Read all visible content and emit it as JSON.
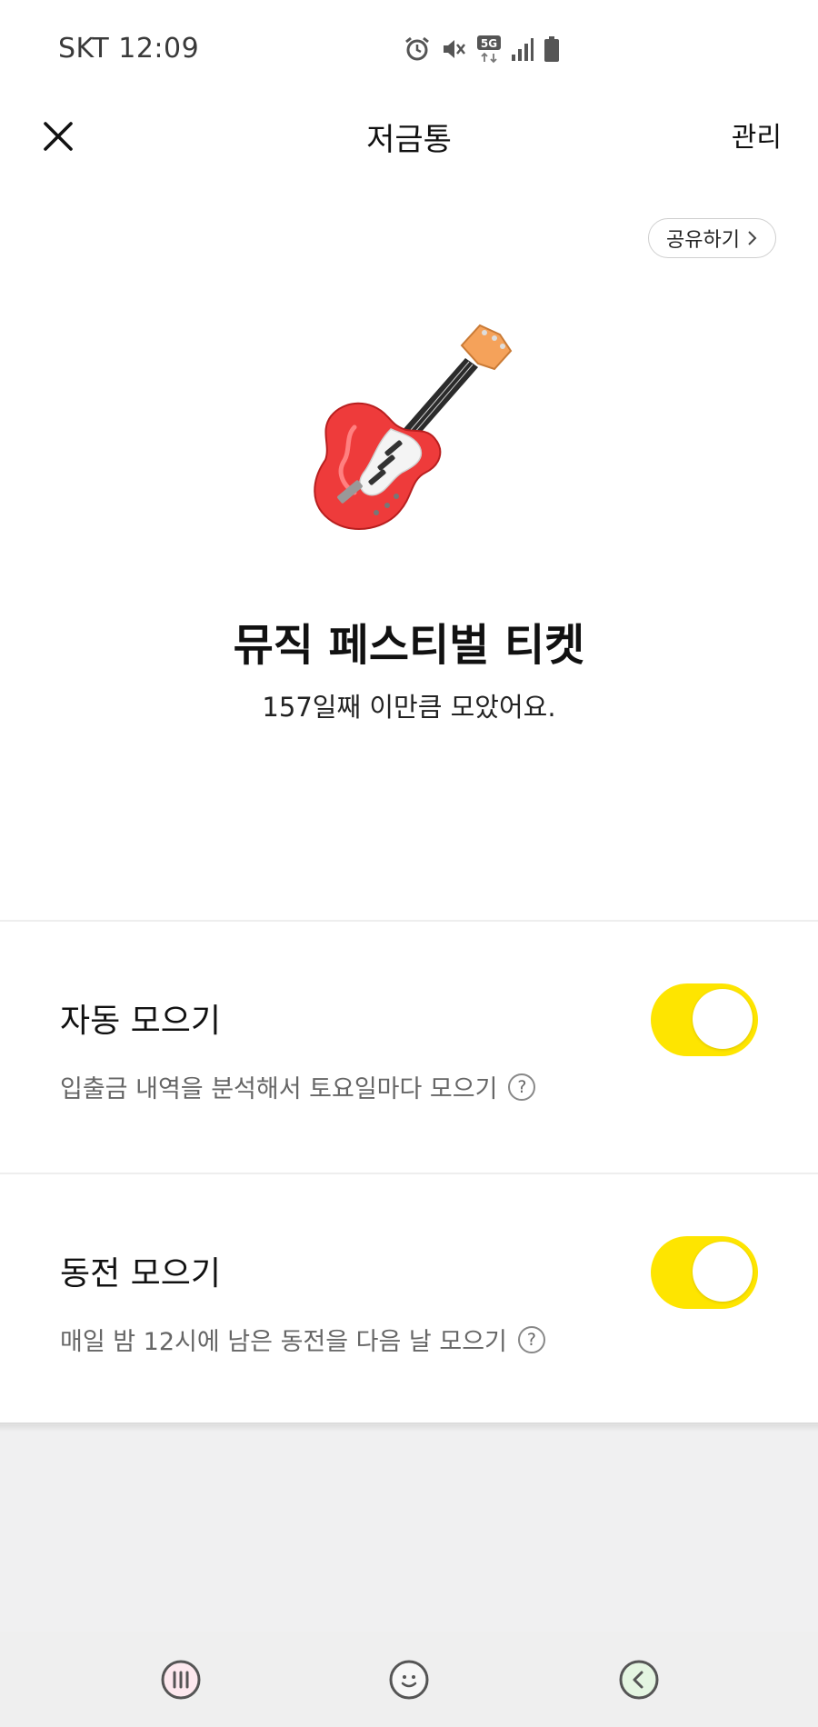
{
  "status_bar": {
    "carrier_time": "SKT 12:09",
    "network_badge": "5G",
    "icons": [
      "alarm-icon",
      "mute-icon",
      "5g-icon",
      "signal-icon",
      "battery-icon"
    ]
  },
  "header": {
    "title": "저금통",
    "close_icon": "close-icon",
    "manage_label": "관리"
  },
  "hero": {
    "share_label": "공유하기",
    "share_icon": "chevron-right-icon",
    "image": "guitar-emoji",
    "title": "뮤직 페스티벌 티켓",
    "subtitle": "157일째 이만큼 모았어요."
  },
  "settings": [
    {
      "title": "자동 모으기",
      "description": "입출금 내역을 분석해서 토요일마다 모으기",
      "help_icon": "help-icon",
      "help_glyph": "?",
      "enabled": true
    },
    {
      "title": "동전 모으기",
      "description": "매일 밤 12시에 남은 동전을 다음 날 모으기",
      "help_icon": "help-icon",
      "help_glyph": "?",
      "enabled": true
    }
  ],
  "nav_bar": {
    "buttons": [
      "recent-apps-icon",
      "home-icon",
      "back-icon"
    ]
  },
  "colors": {
    "toggle_on": "#fee500",
    "background": "#f0f0f1",
    "card": "#ffffff",
    "text_primary": "#111111",
    "text_secondary": "#666666"
  }
}
